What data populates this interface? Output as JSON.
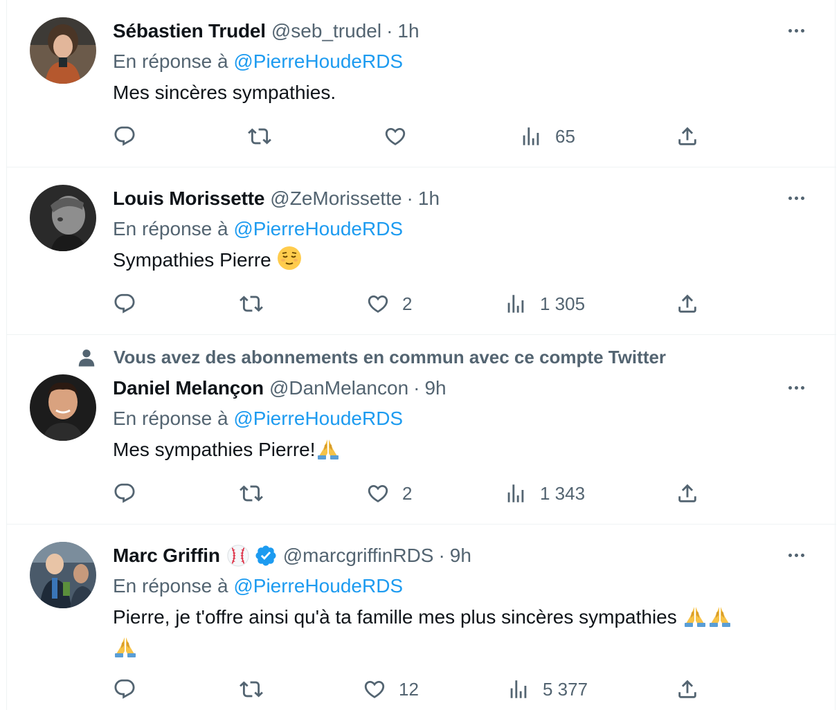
{
  "tweets": [
    {
      "name": "Sébastien Trudel",
      "handle": "@seb_trudel",
      "separator": "·",
      "time": "1h",
      "reply_prefix": "En réponse à ",
      "reply_to": "@PierreHoudeRDS",
      "text": "Mes sincères sympathies.",
      "likes": "",
      "views": "65"
    },
    {
      "name": "Louis Morissette",
      "handle": "@ZeMorissette",
      "separator": "·",
      "time": "1h",
      "reply_prefix": "En réponse à ",
      "reply_to": "@PierreHoudeRDS",
      "text": "Sympathies Pierre",
      "likes": "2",
      "views": "1 305"
    },
    {
      "social_context": "Vous avez des abonnements en commun avec ce compte Twitter",
      "name": "Daniel Melançon",
      "handle": "@DanMelancon",
      "separator": "·",
      "time": "9h",
      "reply_prefix": "En réponse à ",
      "reply_to": "@PierreHoudeRDS",
      "text": "Mes sympathies Pierre!",
      "likes": "2",
      "views": "1 343"
    },
    {
      "name": "Marc Griffin",
      "handle": "@marcgriffinRDS",
      "separator": "·",
      "time": "9h",
      "reply_prefix": "En réponse à ",
      "reply_to": "@PierreHoudeRDS",
      "text": "Pierre, je t'offre ainsi qu'à ta famille mes plus sincères sympathies",
      "likes": "12",
      "views": "5 377"
    }
  ],
  "icons": {
    "reply": "reply-icon",
    "retweet": "retweet-icon",
    "like": "heart-icon",
    "views": "views-icon",
    "share": "share-icon",
    "more": "more-icon",
    "verified": "verified-badge-icon",
    "baseball": "baseball-emoji",
    "relieved": "relieved-face-emoji",
    "pray": "folded-hands-emoji",
    "person": "person-icon"
  },
  "colors": {
    "link": "#1d9bf0",
    "secondary_text": "#536471",
    "primary_text": "#0f1419",
    "divider": "#eff3f4"
  }
}
